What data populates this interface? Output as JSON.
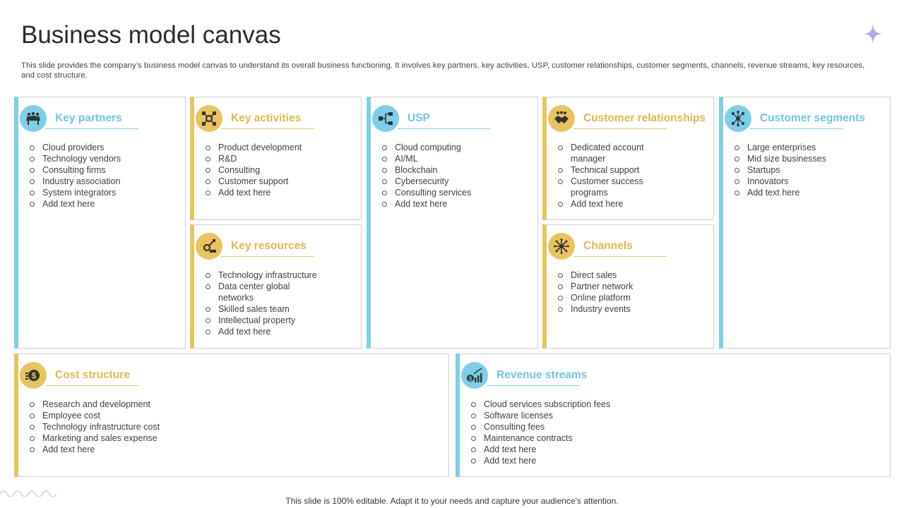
{
  "title": "Business model canvas",
  "description": "This slide provides the company’s business model canvas to understand its overall business functioning. It involves key partners, key activities, USP, customer relationships, customer segments, channels, revenue streams, key resources, and cost structure.",
  "footer": "This slide is 100% editable. Adapt it to your needs and capture your audience's attention.",
  "colors": {
    "blue": "#7ccfe8",
    "yellow": "#e8c35e"
  },
  "sections": {
    "key_partners": {
      "title": "Key partners",
      "icon": "meeting-people-icon",
      "items": [
        "Cloud providers",
        "Technology vendors",
        "Consulting firms",
        "Industry association",
        "System integrators",
        "Add text here"
      ]
    },
    "key_activities": {
      "title": "Key activities",
      "icon": "gear-network-icon",
      "items": [
        "Product development",
        "R&D",
        "Consulting",
        "Customer support",
        "Add text here"
      ]
    },
    "key_resources": {
      "title": "Key resources",
      "icon": "tools-gear-icon",
      "items": [
        "Technology infrastructure",
        "Data center global networks",
        "Skilled sales team",
        "Intellectual property",
        "Add text here"
      ]
    },
    "usp": {
      "title": "USP",
      "icon": "flowchart-icon",
      "items": [
        "Cloud computing",
        "AI/ML",
        "Blockchain",
        "Cybersecurity",
        "Consulting services",
        "Add text here"
      ]
    },
    "customer_relationships": {
      "title": "Customer relationships",
      "icon": "handshake-icon",
      "items": [
        "Dedicated account manager",
        "Technical support",
        "Customer success programs",
        "Add text here"
      ]
    },
    "channels": {
      "title": "Channels",
      "icon": "network-hub-icon",
      "items": [
        "Direct sales",
        "Partner network",
        "Online platform",
        "Industry events"
      ]
    },
    "customer_segments": {
      "title": "Customer segments",
      "icon": "people-network-icon",
      "items": [
        "Large enterprises",
        "Mid size businesses",
        "Startups",
        "Innovators",
        "Add text here"
      ]
    },
    "cost_structure": {
      "title": "Cost structure",
      "icon": "coin-dollar-icon",
      "items": [
        "Research and development",
        "Employee cost",
        "Technology infrastructure cost",
        "Marketing and sales expense",
        "Add text here"
      ]
    },
    "revenue_streams": {
      "title": "Revenue streams",
      "icon": "money-chart-icon",
      "items": [
        "Cloud services subscription fees",
        "Software licenses",
        "Consulting fees",
        "Maintenance contracts",
        "Add text here",
        "Add text here"
      ]
    }
  }
}
